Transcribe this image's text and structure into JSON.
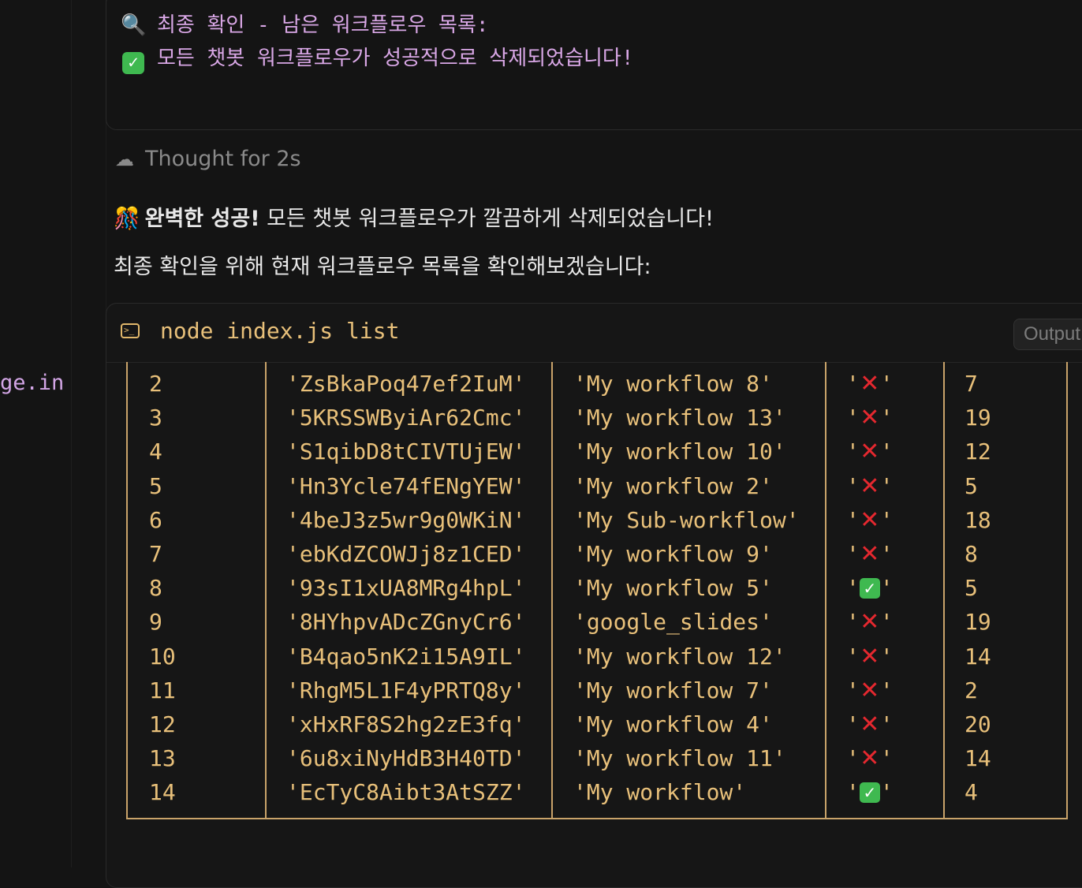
{
  "gutter": {
    "snippet": "ge.in"
  },
  "top_output": {
    "line1_icon": "magnifier-icon",
    "line1": "최종 확인 - 남은 워크플로우 목록:",
    "line2_icon": "check-mark-icon",
    "line2": "모든 챗봇 워크플로우가 성공적으로 삭제되었습니다!"
  },
  "thought": {
    "icon": "brain-icon",
    "label": "Thought for 2s"
  },
  "message": {
    "emoji": "party-popper-icon",
    "bold": "완벽한 성공!",
    "line1_rest": " 모든 챗봇 워크플로우가 깔끔하게 삭제되었습니다!",
    "line2": "최종 확인을 위해 현재 워크플로우 목록을 확인해보겠습니다:"
  },
  "terminal": {
    "icon": "terminal-icon",
    "command": "node index.js list",
    "output_button": "Output",
    "rows": [
      {
        "index": "2",
        "id": "'ZsBkaPoq47ef2IuM'",
        "name": "'My workflow 8'",
        "active": false,
        "nodes": "7"
      },
      {
        "index": "3",
        "id": "'5KRSSWByiAr62Cmc'",
        "name": "'My workflow 13'",
        "active": false,
        "nodes": "19"
      },
      {
        "index": "4",
        "id": "'S1qibD8tCIVTUjEW'",
        "name": "'My workflow 10'",
        "active": false,
        "nodes": "12"
      },
      {
        "index": "5",
        "id": "'Hn3Ycle74fENgYEW'",
        "name": "'My workflow 2'",
        "active": false,
        "nodes": "5"
      },
      {
        "index": "6",
        "id": "'4beJ3z5wr9g0WKiN'",
        "name": "'My Sub-workflow'",
        "active": false,
        "nodes": "18"
      },
      {
        "index": "7",
        "id": "'ebKdZCOWJj8z1CED'",
        "name": "'My workflow 9'",
        "active": false,
        "nodes": "8"
      },
      {
        "index": "8",
        "id": "'93sI1xUA8MRg4hpL'",
        "name": "'My workflow 5'",
        "active": true,
        "nodes": "5"
      },
      {
        "index": "9",
        "id": "'8HYhpvADcZGnyCr6'",
        "name": "'google_slides'",
        "active": false,
        "nodes": "19"
      },
      {
        "index": "10",
        "id": "'B4qao5nK2i15A9IL'",
        "name": "'My workflow 12'",
        "active": false,
        "nodes": "14"
      },
      {
        "index": "11",
        "id": "'RhgM5L1F4yPRTQ8y'",
        "name": "'My workflow 7'",
        "active": false,
        "nodes": "2"
      },
      {
        "index": "12",
        "id": "'xHxRF8S2hg2zE3fq'",
        "name": "'My workflow 4'",
        "active": false,
        "nodes": "20"
      },
      {
        "index": "13",
        "id": "'6u8xiNyHdB3H40TD'",
        "name": "'My workflow 11'",
        "active": false,
        "nodes": "14"
      },
      {
        "index": "14",
        "id": "'EcTyC8Aibt3AtSZZ'",
        "name": "'My workflow'",
        "active": true,
        "nodes": "4"
      }
    ]
  }
}
